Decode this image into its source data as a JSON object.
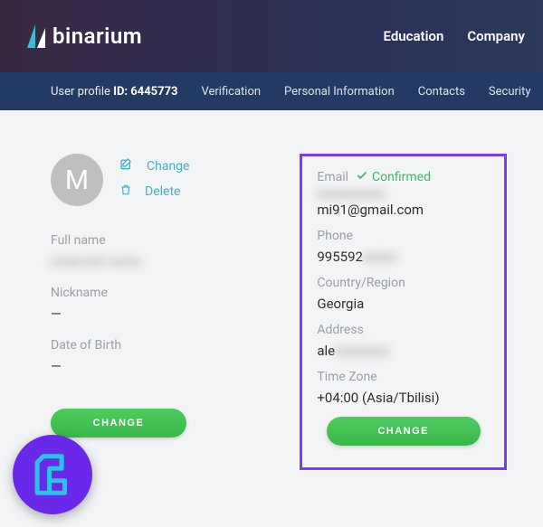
{
  "brand": {
    "name": "binarium"
  },
  "topnav": {
    "education": "Education",
    "company": "Company"
  },
  "subnav": {
    "profile_prefix": "User profile ",
    "profile_id_label": "ID: 6445773",
    "verification": "Verification",
    "personal": "Personal Information",
    "contacts": "Contacts",
    "security": "Security"
  },
  "avatar": {
    "initial": "M",
    "change": "Change",
    "delete": "Delete"
  },
  "left": {
    "fullname_label": "Full name",
    "fullname_value": "redacted name",
    "nickname_label": "Nickname",
    "nickname_value": "—",
    "dob_label": "Date of Birth",
    "dob_value": "—",
    "change_btn": "CHANGE"
  },
  "right": {
    "email_label": "Email",
    "confirmed": "Confirmed",
    "email_hidden": "xxxxxxxxxx",
    "email_visible": "mi91@gmail.com",
    "phone_label": "Phone",
    "phone_visible": "995592",
    "phone_hidden": "xxxxx",
    "country_label": "Country/Region",
    "country_value": "Georgia",
    "address_label": "Address",
    "address_visible": "ale",
    "address_hidden": "xxxxxxxx",
    "tz_label": "Time Zone",
    "tz_value": "+04:00 (Asia/Tbilisi)",
    "change_btn": "CHANGE"
  }
}
